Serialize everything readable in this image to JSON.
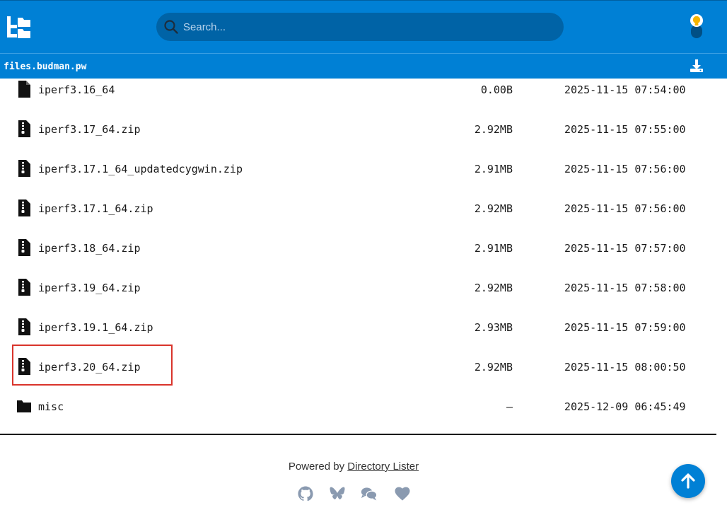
{
  "header": {
    "search_placeholder": "Search..."
  },
  "pathbar": {
    "path": "files.budman.pw"
  },
  "files": [
    {
      "name": "iperf3.16_64",
      "size": "0.00B",
      "date": "2025-11-15 07:54:00",
      "icon": "file-icon"
    },
    {
      "name": "iperf3.17_64.zip",
      "size": "2.92MB",
      "date": "2025-11-15 07:55:00",
      "icon": "file-archive-icon"
    },
    {
      "name": "iperf3.17.1_64_updatedcygwin.zip",
      "size": "2.91MB",
      "date": "2025-11-15 07:56:00",
      "icon": "file-archive-icon"
    },
    {
      "name": "iperf3.17.1_64.zip",
      "size": "2.92MB",
      "date": "2025-11-15 07:56:00",
      "icon": "file-archive-icon"
    },
    {
      "name": "iperf3.18_64.zip",
      "size": "2.91MB",
      "date": "2025-11-15 07:57:00",
      "icon": "file-archive-icon"
    },
    {
      "name": "iperf3.19_64.zip",
      "size": "2.92MB",
      "date": "2025-11-15 07:58:00",
      "icon": "file-archive-icon"
    },
    {
      "name": "iperf3.19.1_64.zip",
      "size": "2.93MB",
      "date": "2025-11-15 07:59:00",
      "icon": "file-archive-icon"
    },
    {
      "name": "iperf3.20_64.zip",
      "size": "2.92MB",
      "date": "2025-11-15 08:00:50",
      "icon": "file-archive-icon"
    },
    {
      "name": "misc",
      "size": "—",
      "date": "2025-12-09 06:45:49",
      "icon": "folder-icon"
    }
  ],
  "footer": {
    "powered_by": "Powered by ",
    "link_text": "Directory Lister"
  },
  "colors": {
    "header_bg": "#0080d5",
    "search_bg": "#0063a6",
    "highlight": "#d9342b"
  }
}
